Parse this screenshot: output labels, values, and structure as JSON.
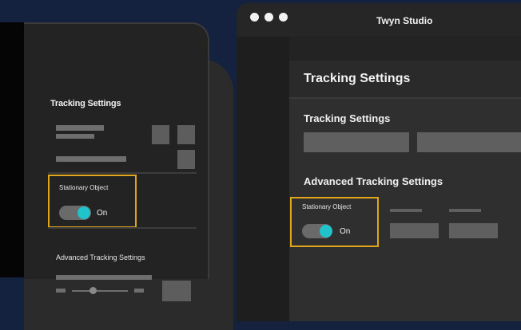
{
  "mobile": {
    "title": "Tracking Settings",
    "stationary_label": "Stationary Object",
    "toggle_state": "On",
    "advanced_label": "Advanced Tracking Settings"
  },
  "window": {
    "app_title": "Twyn Studio",
    "page_title": "Tracking Settings",
    "section_title": "Tracking Settings",
    "advanced_title": "Advanced Tracking Settings",
    "stationary_label": "Stationary Object",
    "toggle_state": "On"
  },
  "colors": {
    "background": "#14223f",
    "highlight": "#e3a61a",
    "toggle_knob": "#1fc3c9"
  }
}
